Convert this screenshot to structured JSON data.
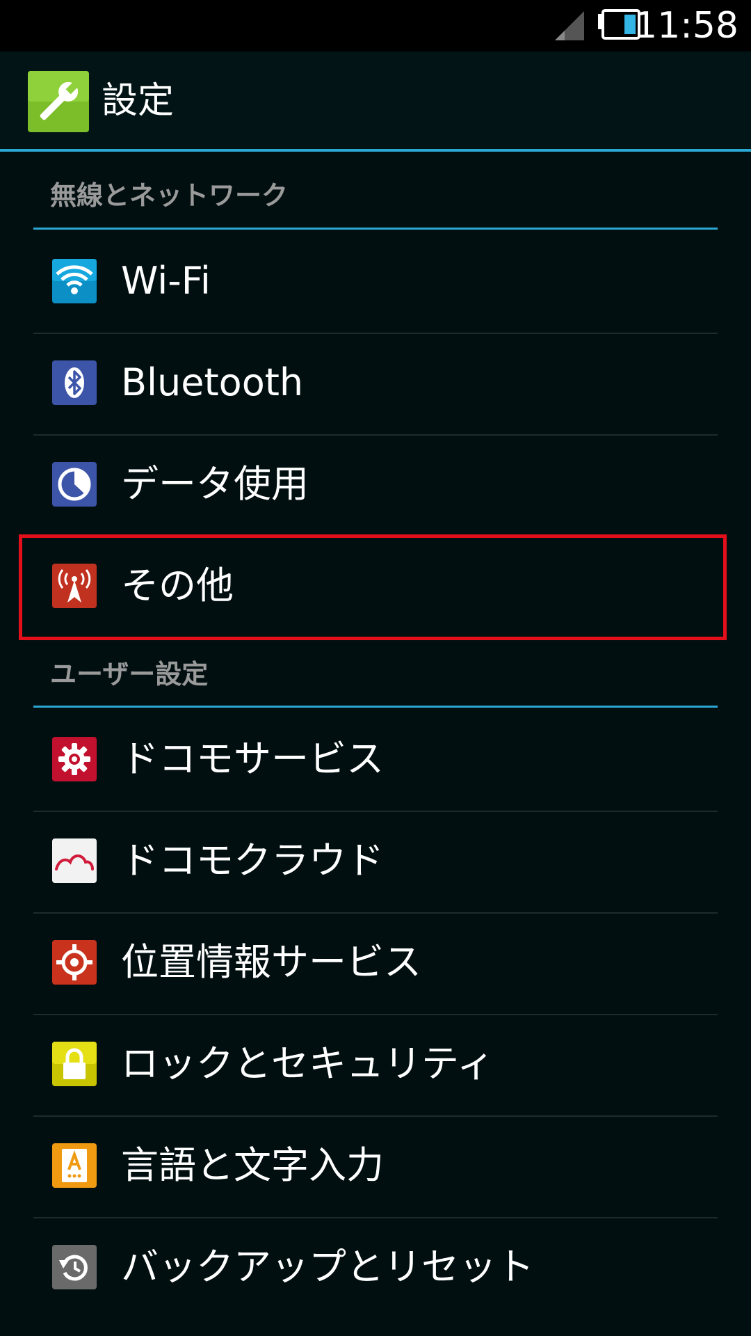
{
  "status_bar": {
    "time": "11:58"
  },
  "action_bar": {
    "title": "設定",
    "icon": "wrench-icon"
  },
  "sections": {
    "wireless": {
      "header": "無線とネットワーク",
      "items": [
        {
          "label": "Wi-Fi",
          "icon": "wifi-icon"
        },
        {
          "label": "Bluetooth",
          "icon": "bluetooth-icon"
        },
        {
          "label": "データ使用",
          "icon": "data-usage-icon"
        },
        {
          "label": "その他",
          "icon": "antenna-icon"
        }
      ]
    },
    "user": {
      "header": "ユーザー設定",
      "items": [
        {
          "label": "ドコモサービス",
          "icon": "docomo-gear-icon"
        },
        {
          "label": "ドコモクラウド",
          "icon": "docomo-cloud-icon"
        },
        {
          "label": "位置情報サービス",
          "icon": "location-target-icon"
        },
        {
          "label": "ロックとセキュリティ",
          "icon": "lock-icon"
        },
        {
          "label": "言語と文字入力",
          "icon": "language-input-icon"
        },
        {
          "label": "バックアップとリセット",
          "icon": "backup-reset-icon"
        }
      ]
    }
  },
  "colors": {
    "background": "#020f11",
    "accent": "#2aa7d3",
    "highlight_border": "#e3101b",
    "section_header_text": "#9a9a9a"
  }
}
